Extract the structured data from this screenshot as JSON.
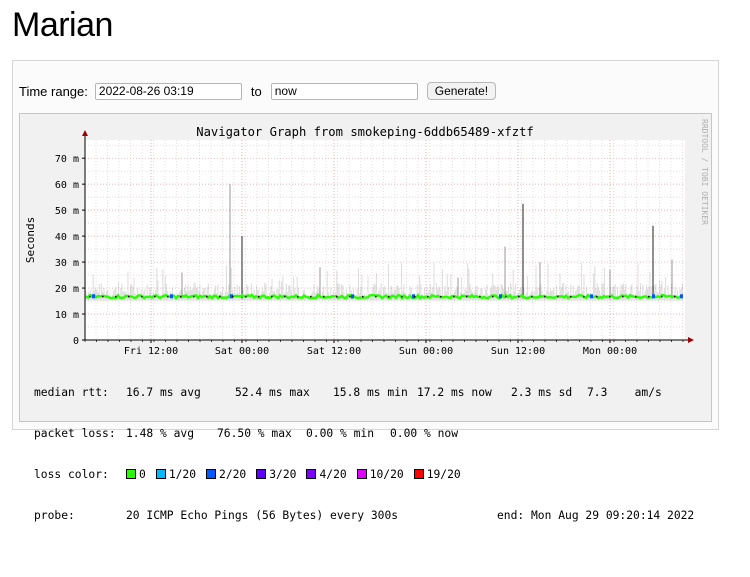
{
  "page": {
    "title": "Marian"
  },
  "form": {
    "time_range_label": "Time range:",
    "start_value": "2022-08-26 03:19",
    "to_label": "to",
    "end_value": "now",
    "generate_label": "Generate!"
  },
  "graph": {
    "title": "Navigator Graph from smokeping-6ddb65489-xfztf",
    "side_credit": "RRDTOOL / TOBI OETIKER",
    "ylabel": "Seconds",
    "y_ticks": [
      "0",
      "10 m",
      "20 m",
      "30 m",
      "40 m",
      "50 m",
      "60 m",
      "70 m"
    ],
    "x_ticks": [
      "Fri 12:00",
      "Sat 00:00",
      "Sat 12:00",
      "Sun 00:00",
      "Sun 12:00",
      "Mon 00:00"
    ]
  },
  "legend": {
    "median_label": "median rtt:",
    "median_avg": "16.7 ms avg",
    "median_max": "52.4 ms max",
    "median_min": "15.8 ms min",
    "median_now": "17.2 ms now",
    "median_sd": "2.3 ms sd",
    "median_ams": "7.3    am/s",
    "loss_label": "packet loss:",
    "loss_avg": "1.48 % avg",
    "loss_max": "76.50 % max",
    "loss_min": "0.00 % min",
    "loss_now": "0.00 % now",
    "color_label": "loss color:",
    "loss_colors": [
      {
        "label": "0",
        "color": "#26ff00"
      },
      {
        "label": "1/20",
        "color": "#00b8ff"
      },
      {
        "label": "2/20",
        "color": "#0059ff"
      },
      {
        "label": "3/20",
        "color": "#5e00ff"
      },
      {
        "label": "4/20",
        "color": "#7e00ff"
      },
      {
        "label": "10/20",
        "color": "#dd00ff"
      },
      {
        "label": "19/20",
        "color": "#ff0000"
      }
    ],
    "probe_label": "probe:",
    "probe_value": "20 ICMP Echo Pings (56 Bytes) every 300s",
    "end_value": "end: Mon Aug 29 09:20:14 2022"
  },
  "chart_data": {
    "type": "line",
    "title": "Navigator Graph from smokeping-6ddb65489-xfztf",
    "xlabel": "",
    "ylabel": "Seconds",
    "ylim": [
      0,
      77
    ],
    "y_unit": "ms",
    "x": [
      "Fri 12:00",
      "Sat 00:00",
      "Sat 12:00",
      "Sun 00:00",
      "Sun 12:00",
      "Mon 00:00"
    ],
    "x_range_hours": [
      "Fri 03:19",
      "Mon 09:20"
    ],
    "series": [
      {
        "name": "median rtt",
        "median_level": 16.7,
        "min": 15.8,
        "max": 52.4,
        "spikes": [
          {
            "x": "Sun 12:00",
            "y": 52.4
          },
          {
            "x": "Mon 04:00",
            "y": 44
          },
          {
            "x": "Sat 00:00",
            "y": 40
          }
        ]
      }
    ],
    "grid": true,
    "legend": "bottom"
  },
  "colors": {
    "page_bg": "#ffffff",
    "graph_bg": "#f1f1f1",
    "plot_bg": "#ffffff",
    "grid_minor": "#e0c8c8",
    "grid_major": "#d9a0a0",
    "axis": "#000000",
    "arrow": "#a00000",
    "median_line": "#26ff00"
  }
}
